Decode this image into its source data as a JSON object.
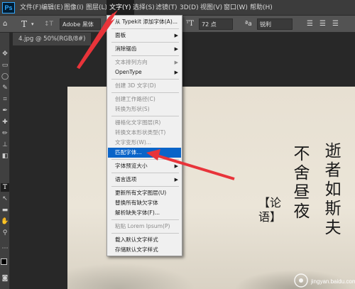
{
  "menubar": {
    "logo": "Ps",
    "items": [
      "文件(F)",
      "编辑(E)",
      "图像(I)",
      "图层(L)",
      "文字(Y)",
      "选择(S)",
      "滤镜(T)",
      "3D(D)",
      "视图(V)",
      "窗口(W)",
      "帮助(H)"
    ],
    "active_index": 4
  },
  "options": {
    "tool_glyph": "T",
    "orient_glyph": "↕T",
    "font_family": "Adobe 黑体 Std",
    "font_size": "72 点",
    "antialias": "锐利"
  },
  "document": {
    "tab_label": "4.jpg @ 50%(RGB/8#)"
  },
  "menu": {
    "items": [
      {
        "label": "从 Typekit 添加字体(A)...",
        "disabled": false,
        "submenu": false
      },
      {
        "label": "面板",
        "disabled": false,
        "submenu": true
      },
      {
        "label": "消除锯齿",
        "disabled": false,
        "submenu": true
      },
      {
        "label": "文本排列方向",
        "disabled": true,
        "submenu": true
      },
      {
        "label": "OpenType",
        "disabled": false,
        "submenu": true
      },
      {
        "label": "创建 3D 文字(D)",
        "disabled": true,
        "submenu": false
      },
      {
        "label": "创建工作路径(C)",
        "disabled": true,
        "submenu": false
      },
      {
        "label": "转换为形状(S)",
        "disabled": true,
        "submenu": false
      },
      {
        "label": "栅格化文字图层(R)",
        "disabled": true,
        "submenu": false
      },
      {
        "label": "转换文本形状类型(T)",
        "disabled": true,
        "submenu": false
      },
      {
        "label": "文字变形(W)...",
        "disabled": true,
        "submenu": false
      },
      {
        "label": "匹配字体...",
        "disabled": false,
        "submenu": false,
        "highlighted": true
      },
      {
        "label": "字体预览大小",
        "disabled": false,
        "submenu": true
      },
      {
        "label": "语言选项",
        "disabled": false,
        "submenu": true
      },
      {
        "label": "更新所有文字图层(U)",
        "disabled": false,
        "submenu": false
      },
      {
        "label": "替换所有缺欠字体",
        "disabled": false,
        "submenu": false
      },
      {
        "label": "解析缺失字体(F)...",
        "disabled": false,
        "submenu": false
      },
      {
        "label": "粘贴 Lorem Ipsum(P)",
        "disabled": true,
        "submenu": false
      },
      {
        "label": "载入默认文字样式",
        "disabled": false,
        "submenu": false
      },
      {
        "label": "存储默认文字样式",
        "disabled": false,
        "submenu": false
      }
    ]
  },
  "artwork": {
    "column1": "逝者如斯夫",
    "column2": "不舍昼夜",
    "seal": "【论语】"
  },
  "watermark": {
    "text": "jingyan.baidu.com"
  },
  "colors": {
    "highlight": "#0a64c8",
    "arrow": "#e8343a"
  }
}
